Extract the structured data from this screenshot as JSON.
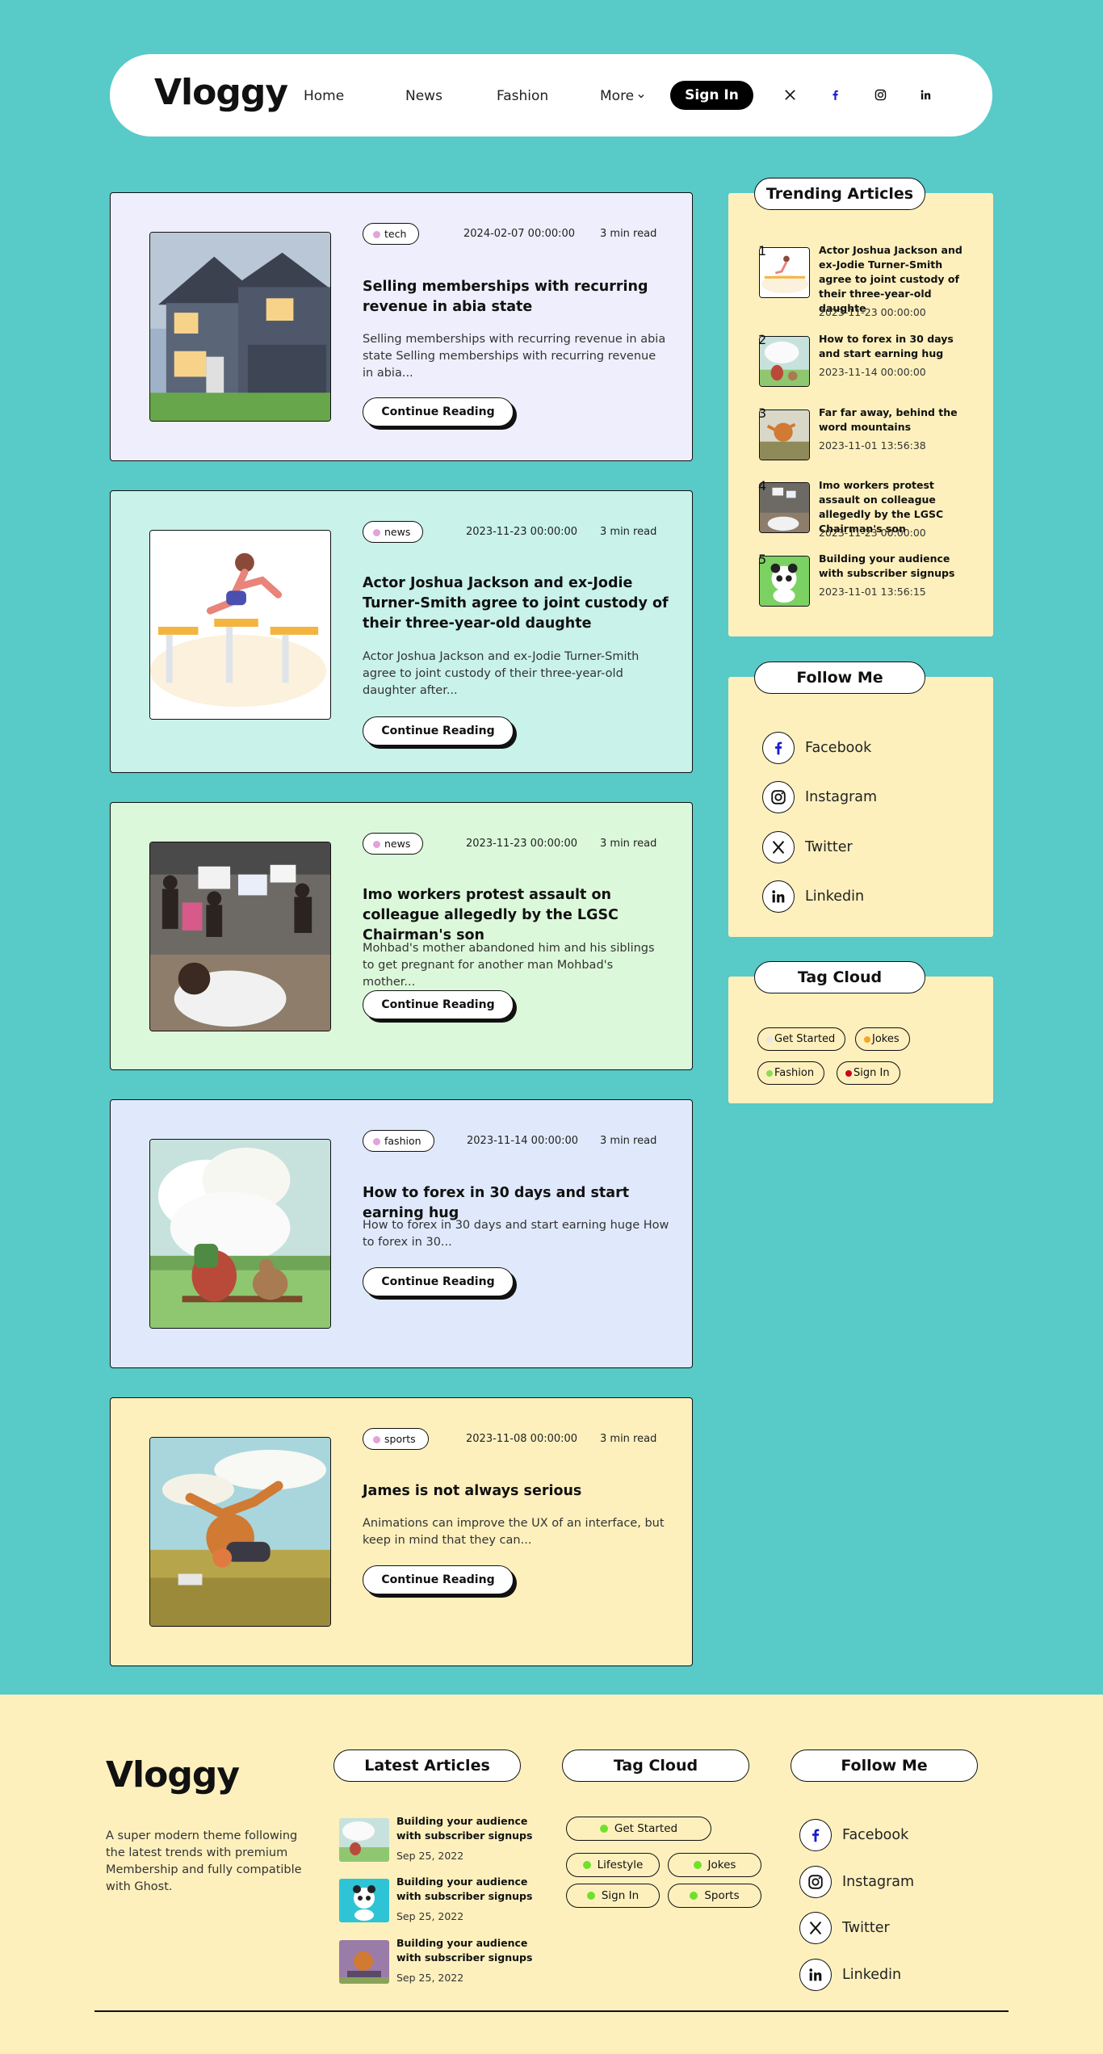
{
  "site": {
    "logo": "Vloggy"
  },
  "nav": {
    "links": [
      "Home",
      "News",
      "Fashion"
    ],
    "more_label": "More",
    "signin_label": "Sign In",
    "social_icons": [
      "x-icon",
      "facebook-icon",
      "instagram-icon",
      "linkedin-icon"
    ]
  },
  "articles": [
    {
      "tag": "tech",
      "date": "2024-02-07 00:00:00",
      "read": "3 min read",
      "title": "Selling memberships with recurring revenue in abia state",
      "excerpt": "Selling memberships with recurring revenue in abia state Selling memberships with recurring revenue in abia...",
      "cta": "Continue Reading",
      "bg": "#eeeefc"
    },
    {
      "tag": "news",
      "date": "2023-11-23 00:00:00",
      "read": "3 min read",
      "title": "Actor Joshua Jackson and ex-Jodie Turner-Smith agree to joint custody of their three-year-old daughte",
      "excerpt": "Actor Joshua Jackson and ex-Jodie Turner-Smith agree to joint custody of their three-year-old daughter after...",
      "cta": "Continue Reading",
      "bg": "#c8f2ea"
    },
    {
      "tag": "news",
      "date": "2023-11-23 00:00:00",
      "read": "3 min read",
      "title": "Imo workers protest assault on colleague allegedly by the LGSC Chairman's son",
      "excerpt": "Mohbad's mother abandoned him and his siblings to get pregnant for another man Mohbad's mother...",
      "cta": "Continue Reading",
      "bg": "#dcf8da"
    },
    {
      "tag": "fashion",
      "date": "2023-11-14 00:00:00",
      "read": "3 min read",
      "title": "How to forex in 30 days and start earning hug",
      "excerpt": "How to forex in 30 days and start earning huge How to forex in 30...",
      "cta": "Continue Reading",
      "bg": "#dfe9fb"
    },
    {
      "tag": "sports",
      "date": "2023-11-08 00:00:00",
      "read": "3 min read",
      "title": "James is not always serious",
      "excerpt": "Animations can improve the UX of an interface, but keep in mind that they can...",
      "cta": "Continue Reading",
      "bg": "#fdf0bd"
    }
  ],
  "sidebar": {
    "trending_title": "Trending Articles",
    "trending": [
      {
        "num": "1",
        "title": "Actor Joshua Jackson and ex-Jodie Turner-Smith agree to joint custody of their three-year-old daughte",
        "date": "2023-11-23 00:00:00"
      },
      {
        "num": "2",
        "title": "How to forex in 30 days and start earning hug",
        "date": "2023-11-14 00:00:00"
      },
      {
        "num": "3",
        "title": "Far far away, behind the word mountains",
        "date": "2023-11-01 13:56:38"
      },
      {
        "num": "4",
        "title": "Imo workers protest assault on colleague allegedly by the LGSC Chairman's son",
        "date": "2023-11-23 00:00:00"
      },
      {
        "num": "5",
        "title": "Building your audience with subscriber signups",
        "date": "2023-11-01 13:56:15"
      }
    ],
    "follow_title": "Follow Me",
    "follow": [
      "Facebook",
      "Instagram",
      "Twitter",
      "Linkedin"
    ],
    "cloud_title": "Tag Cloud",
    "cloud": [
      {
        "label": "Get Started",
        "color": "#e8e8e8"
      },
      {
        "label": "Jokes",
        "color": "#f5a623"
      },
      {
        "label": "Fashion",
        "color": "#8bdc57"
      },
      {
        "label": "Sign In",
        "color": "#d0021b"
      }
    ]
  },
  "footer": {
    "logo": "Vloggy",
    "description": "A super modern theme following the latest trends with premium Membership and fully compatible with Ghost.",
    "latest_title": "Latest Articles",
    "latest": [
      {
        "title": "Building your audience with subscriber signups",
        "date": "Sep 25, 2022"
      },
      {
        "title": "Building your audience with subscriber signups",
        "date": "Sep 25, 2022"
      },
      {
        "title": "Building your audience with subscriber signups",
        "date": "Sep 25, 2022"
      }
    ],
    "cloud_title": "Tag Cloud",
    "cloud": [
      "Get Started",
      "Lifestyle",
      "Jokes",
      "Sign In",
      "Sports"
    ],
    "follow_title": "Follow Me",
    "follow": [
      "Facebook",
      "Instagram",
      "Twitter",
      "Linkedin"
    ]
  }
}
